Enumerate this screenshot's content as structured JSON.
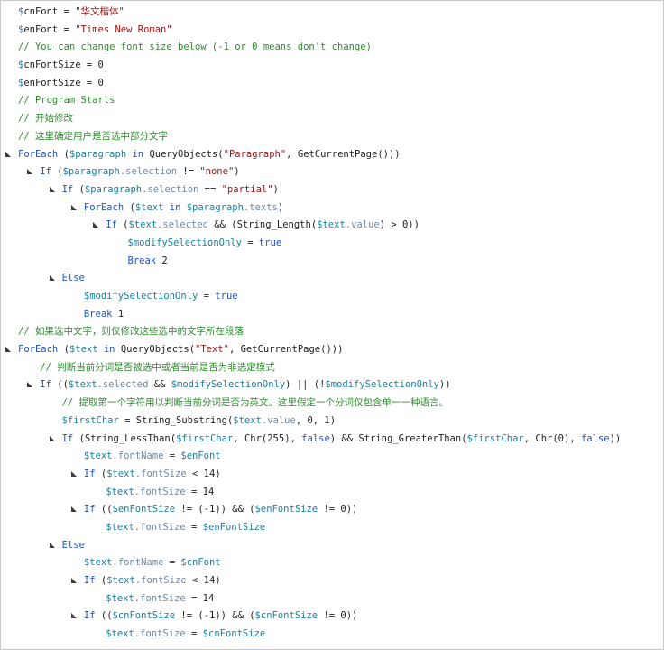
{
  "lines": [
    {
      "caret": false,
      "indent": 0,
      "tokens": [
        [
          "v",
          "$"
        ],
        [
          "vv",
          "cnFont"
        ],
        [
          "o",
          " = "
        ],
        [
          "s",
          "\"华文楷体\""
        ]
      ]
    },
    {
      "caret": false,
      "indent": 0,
      "tokens": [
        [
          "v",
          "$"
        ],
        [
          "vv",
          "enFont"
        ],
        [
          "o",
          " = "
        ],
        [
          "s",
          "\"Times New Roman\""
        ]
      ]
    },
    {
      "caret": false,
      "indent": 0,
      "tokens": [
        [
          "c",
          "// You can change font size below (-1 or 0 means don't change)"
        ]
      ]
    },
    {
      "caret": false,
      "indent": 0,
      "tokens": [
        [
          "v",
          "$"
        ],
        [
          "vv",
          "cnFontSize"
        ],
        [
          "o",
          " = "
        ],
        [
          "n",
          "0"
        ]
      ]
    },
    {
      "caret": false,
      "indent": 0,
      "tokens": [
        [
          "v",
          "$"
        ],
        [
          "vv",
          "enFontSize"
        ],
        [
          "o",
          " = "
        ],
        [
          "n",
          "0"
        ]
      ]
    },
    {
      "caret": false,
      "indent": 0,
      "tokens": [
        [
          "c",
          "// Program Starts"
        ]
      ]
    },
    {
      "caret": false,
      "indent": 0,
      "tokens": [
        [
          "c",
          "// 开始修改"
        ]
      ]
    },
    {
      "caret": false,
      "indent": 0,
      "tokens": [
        [
          "c",
          "// 这里确定用户是否选中部分文字"
        ]
      ]
    },
    {
      "caret": true,
      "indent": 0,
      "tokens": [
        [
          "k",
          "ForEach"
        ],
        [
          "o",
          " ("
        ],
        [
          "v",
          "$paragraph"
        ],
        [
          "k",
          " in "
        ],
        [
          "f",
          "QueryObjects"
        ],
        [
          "o",
          "("
        ],
        [
          "s",
          "\"Paragraph\""
        ],
        [
          "o",
          ", "
        ],
        [
          "f",
          "GetCurrentPage"
        ],
        [
          "o",
          "()))"
        ]
      ]
    },
    {
      "caret": true,
      "indent": 1,
      "tokens": [
        [
          "k",
          "If"
        ],
        [
          "o",
          " ("
        ],
        [
          "v",
          "$paragraph"
        ],
        [
          "p",
          ".selection"
        ],
        [
          "o",
          " != "
        ],
        [
          "s",
          "\"none\""
        ],
        [
          "o",
          ")"
        ]
      ]
    },
    {
      "caret": true,
      "indent": 2,
      "tokens": [
        [
          "k",
          "If"
        ],
        [
          "o",
          " ("
        ],
        [
          "v",
          "$paragraph"
        ],
        [
          "p",
          ".selection"
        ],
        [
          "o",
          " == "
        ],
        [
          "s",
          "\"partial\""
        ],
        [
          "o",
          ")"
        ]
      ]
    },
    {
      "caret": true,
      "indent": 3,
      "tokens": [
        [
          "k",
          "ForEach"
        ],
        [
          "o",
          " ("
        ],
        [
          "v",
          "$text"
        ],
        [
          "k",
          " in "
        ],
        [
          "v",
          "$paragraph"
        ],
        [
          "p",
          ".texts"
        ],
        [
          "o",
          ")"
        ]
      ]
    },
    {
      "caret": true,
      "indent": 4,
      "tokens": [
        [
          "k",
          "If"
        ],
        [
          "o",
          " ("
        ],
        [
          "v",
          "$text"
        ],
        [
          "p",
          ".selected"
        ],
        [
          "o",
          " && ("
        ],
        [
          "f",
          "String_Length"
        ],
        [
          "o",
          "("
        ],
        [
          "v",
          "$text"
        ],
        [
          "p",
          ".value"
        ],
        [
          "o",
          ") > 0))"
        ]
      ]
    },
    {
      "caret": false,
      "indent": 5,
      "tokens": [
        [
          "v",
          "$"
        ],
        [
          "v",
          "modifySelectionOnly"
        ],
        [
          "o",
          " = "
        ],
        [
          "k",
          "true"
        ]
      ]
    },
    {
      "caret": false,
      "indent": 5,
      "tokens": [
        [
          "k",
          "Break"
        ],
        [
          "n",
          " 2"
        ]
      ]
    },
    {
      "caret": true,
      "indent": 2,
      "tokens": [
        [
          "k",
          "Else"
        ]
      ]
    },
    {
      "caret": false,
      "indent": 3,
      "tokens": [
        [
          "v",
          "$"
        ],
        [
          "v",
          "modifySelectionOnly"
        ],
        [
          "o",
          " = "
        ],
        [
          "k",
          "true"
        ]
      ]
    },
    {
      "caret": false,
      "indent": 3,
      "tokens": [
        [
          "k",
          "Break"
        ],
        [
          "n",
          " 1"
        ]
      ]
    },
    {
      "caret": false,
      "indent": 0,
      "tokens": [
        [
          "c",
          "// 如果选中文字，则仅修改这些选中的文字所在段落"
        ]
      ]
    },
    {
      "caret": true,
      "indent": 0,
      "tokens": [
        [
          "k",
          "ForEach"
        ],
        [
          "o",
          " ("
        ],
        [
          "v",
          "$text"
        ],
        [
          "k",
          " in "
        ],
        [
          "f",
          "QueryObjects"
        ],
        [
          "o",
          "("
        ],
        [
          "s",
          "\"Text\""
        ],
        [
          "o",
          ", "
        ],
        [
          "f",
          "GetCurrentPage"
        ],
        [
          "o",
          "()))"
        ]
      ]
    },
    {
      "caret": false,
      "indent": 1,
      "tokens": [
        [
          "c",
          "// 判断当前分词是否被选中或者当前是否为非选定模式"
        ]
      ]
    },
    {
      "caret": true,
      "indent": 1,
      "tokens": [
        [
          "k",
          "If"
        ],
        [
          "o",
          " (("
        ],
        [
          "v",
          "$text"
        ],
        [
          "p",
          ".selected"
        ],
        [
          "o",
          " && "
        ],
        [
          "v",
          "$modifySelectionOnly"
        ],
        [
          "o",
          ") || (!"
        ],
        [
          "v",
          "$modifySelectionOnly"
        ],
        [
          "o",
          "))"
        ]
      ]
    },
    {
      "caret": false,
      "indent": 2,
      "tokens": [
        [
          "c",
          "// 提取第一个字符用以判断当前分词是否为英文。这里假定一个分词仅包含单一一种语言。"
        ]
      ]
    },
    {
      "caret": false,
      "indent": 2,
      "tokens": [
        [
          "v",
          "$firstChar"
        ],
        [
          "o",
          " = "
        ],
        [
          "f",
          "String_Substring"
        ],
        [
          "o",
          "("
        ],
        [
          "v",
          "$text"
        ],
        [
          "p",
          ".value"
        ],
        [
          "o",
          ", 0, 1)"
        ]
      ]
    },
    {
      "caret": true,
      "indent": 2,
      "tokens": [
        [
          "k",
          "If"
        ],
        [
          "o",
          " ("
        ],
        [
          "f",
          "String_LessThan"
        ],
        [
          "o",
          "("
        ],
        [
          "v",
          "$firstChar"
        ],
        [
          "o",
          ", "
        ],
        [
          "f",
          "Chr"
        ],
        [
          "o",
          "(255), "
        ],
        [
          "k",
          "false"
        ],
        [
          "o",
          ") && "
        ],
        [
          "f",
          "String_GreaterThan"
        ],
        [
          "o",
          "("
        ],
        [
          "v",
          "$firstChar"
        ],
        [
          "o",
          ", "
        ],
        [
          "f",
          "Chr"
        ],
        [
          "o",
          "(0), "
        ],
        [
          "k",
          "false"
        ],
        [
          "o",
          "))"
        ]
      ]
    },
    {
      "caret": false,
      "indent": 3,
      "tokens": [
        [
          "v",
          "$text"
        ],
        [
          "p",
          ".fontName"
        ],
        [
          "o",
          " = "
        ],
        [
          "v",
          "$enFont"
        ]
      ]
    },
    {
      "caret": true,
      "indent": 3,
      "tokens": [
        [
          "k",
          "If"
        ],
        [
          "o",
          " ("
        ],
        [
          "v",
          "$text"
        ],
        [
          "p",
          ".fontSize"
        ],
        [
          "o",
          " < 14)"
        ]
      ]
    },
    {
      "caret": false,
      "indent": 4,
      "tokens": [
        [
          "v",
          "$text"
        ],
        [
          "p",
          ".fontSize"
        ],
        [
          "o",
          " = 14"
        ]
      ]
    },
    {
      "caret": true,
      "indent": 3,
      "tokens": [
        [
          "k",
          "If"
        ],
        [
          "o",
          " (("
        ],
        [
          "v",
          "$enFontSize"
        ],
        [
          "o",
          " != (-1)) && ("
        ],
        [
          "v",
          "$enFontSize"
        ],
        [
          "o",
          " != 0))"
        ]
      ]
    },
    {
      "caret": false,
      "indent": 4,
      "tokens": [
        [
          "v",
          "$text"
        ],
        [
          "p",
          ".fontSize"
        ],
        [
          "o",
          " = "
        ],
        [
          "v",
          "$enFontSize"
        ]
      ]
    },
    {
      "caret": true,
      "indent": 2,
      "tokens": [
        [
          "k",
          "Else"
        ]
      ]
    },
    {
      "caret": false,
      "indent": 3,
      "tokens": [
        [
          "v",
          "$text"
        ],
        [
          "p",
          ".fontName"
        ],
        [
          "o",
          " = "
        ],
        [
          "v",
          "$cnFont"
        ]
      ]
    },
    {
      "caret": true,
      "indent": 3,
      "tokens": [
        [
          "k",
          "If"
        ],
        [
          "o",
          " ("
        ],
        [
          "v",
          "$text"
        ],
        [
          "p",
          ".fontSize"
        ],
        [
          "o",
          " < 14)"
        ]
      ]
    },
    {
      "caret": false,
      "indent": 4,
      "tokens": [
        [
          "v",
          "$text"
        ],
        [
          "p",
          ".fontSize"
        ],
        [
          "o",
          " = 14"
        ]
      ]
    },
    {
      "caret": true,
      "indent": 3,
      "tokens": [
        [
          "k",
          "If"
        ],
        [
          "o",
          " (("
        ],
        [
          "v",
          "$cnFontSize"
        ],
        [
          "o",
          " != (-1)) && ("
        ],
        [
          "v",
          "$cnFontSize"
        ],
        [
          "o",
          " != 0))"
        ]
      ]
    },
    {
      "caret": false,
      "indent": 4,
      "tokens": [
        [
          "v",
          "$text"
        ],
        [
          "p",
          ".fontSize"
        ],
        [
          "o",
          " = "
        ],
        [
          "v",
          "$cnFontSize"
        ]
      ]
    }
  ]
}
